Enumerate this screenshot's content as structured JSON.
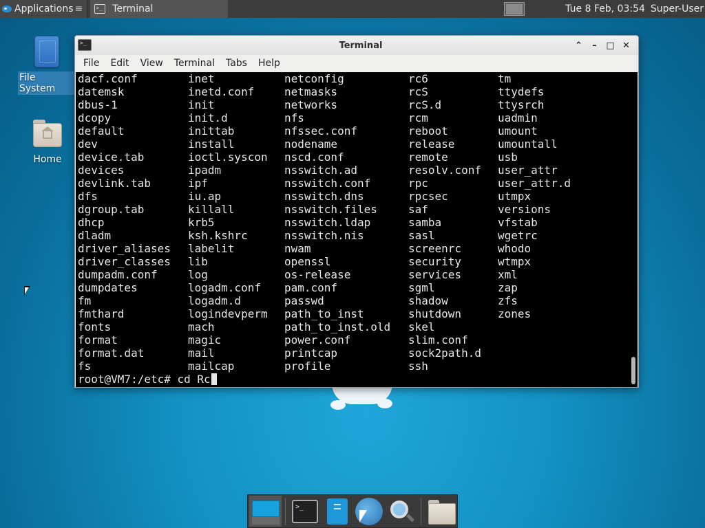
{
  "top_panel": {
    "applications_label": "Applications",
    "applications_overflow": "≡",
    "task_title": "Terminal",
    "clock": "Tue  8 Feb, 03:54",
    "user": "Super-User"
  },
  "desktop": {
    "icons": [
      {
        "label": "File System",
        "icon": "drive-icon"
      },
      {
        "label": "Home",
        "icon": "home-folder-icon"
      }
    ]
  },
  "window": {
    "title": "Terminal",
    "controls": {
      "shade": "⌃",
      "minimize": "–",
      "maximize": "□",
      "close": "✕"
    },
    "menu": [
      "File",
      "Edit",
      "View",
      "Terminal",
      "Tabs",
      "Help"
    ]
  },
  "terminal": {
    "rows": [
      [
        "dacf.conf",
        "inet",
        "netconfig",
        "rc6",
        "tm"
      ],
      [
        "datemsk",
        "inetd.conf",
        "netmasks",
        "rcS",
        "ttydefs"
      ],
      [
        "dbus-1",
        "init",
        "networks",
        "rcS.d",
        "ttysrch"
      ],
      [
        "dcopy",
        "init.d",
        "nfs",
        "rcm",
        "uadmin"
      ],
      [
        "default",
        "inittab",
        "nfssec.conf",
        "reboot",
        "umount"
      ],
      [
        "dev",
        "install",
        "nodename",
        "release",
        "umountall"
      ],
      [
        "device.tab",
        "ioctl.syscon",
        "nscd.conf",
        "remote",
        "usb"
      ],
      [
        "devices",
        "ipadm",
        "nsswitch.ad",
        "resolv.conf",
        "user_attr"
      ],
      [
        "devlink.tab",
        "ipf",
        "nsswitch.conf",
        "rpc",
        "user_attr.d"
      ],
      [
        "dfs",
        "iu.ap",
        "nsswitch.dns",
        "rpcsec",
        "utmpx"
      ],
      [
        "dgroup.tab",
        "killall",
        "nsswitch.files",
        "saf",
        "versions"
      ],
      [
        "dhcp",
        "krb5",
        "nsswitch.ldap",
        "samba",
        "vfstab"
      ],
      [
        "dladm",
        "ksh.kshrc",
        "nsswitch.nis",
        "sasl",
        "wgetrc"
      ],
      [
        "driver_aliases",
        "labelit",
        "nwam",
        "screenrc",
        "whodo"
      ],
      [
        "driver_classes",
        "lib",
        "openssl",
        "security",
        "wtmpx"
      ],
      [
        "dumpadm.conf",
        "log",
        "os-release",
        "services",
        "xml"
      ],
      [
        "dumpdates",
        "logadm.conf",
        "pam.conf",
        "sgml",
        "zap"
      ],
      [
        "fm",
        "logadm.d",
        "passwd",
        "shadow",
        "zfs"
      ],
      [
        "fmthard",
        "logindevperm",
        "path_to_inst",
        "shutdown",
        "zones"
      ],
      [
        "fonts",
        "mach",
        "path_to_inst.old",
        "skel",
        ""
      ],
      [
        "format",
        "magic",
        "power.conf",
        "slim.conf",
        ""
      ],
      [
        "format.dat",
        "mail",
        "printcap",
        "sock2path.d",
        ""
      ],
      [
        "fs",
        "mailcap",
        "profile",
        "ssh",
        ""
      ]
    ],
    "prompt": "root@VM7:/etc# cd Rc"
  },
  "dock": {
    "items": [
      "show-desktop-icon",
      "terminal-icon",
      "file-manager-phone-icon",
      "web-browser-icon",
      "app-finder-icon",
      "home-folder-icon"
    ]
  }
}
